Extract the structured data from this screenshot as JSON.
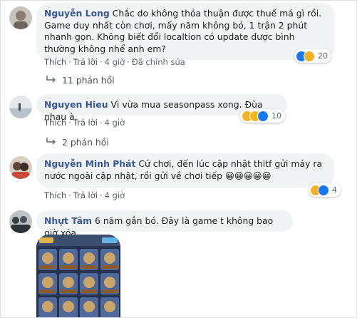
{
  "colors": {
    "name": "#385898",
    "link": "#4b4f56",
    "bubble": "#f2f3f5",
    "like": "#1877f2",
    "haha": "#f7b125"
  },
  "comments": [
    {
      "author": "Nguyễn Long",
      "text": "Chắc do không thỏa thuận được thuế má gì rồi. Game duy nhất còn chơi, mấy năm không bỏ, 1 trận 2 phút nhanh gọn. Không biết đổi localtion có update được bình thường không nhể anh em?",
      "like": "Thích",
      "reply": "Trả lời",
      "time": "4 giờ",
      "edited": "Đã chỉnh sửa",
      "reactions": {
        "icons": [
          "like-icon",
          "sad-icon"
        ],
        "count": "20"
      },
      "replies": "11 phản hồi"
    },
    {
      "author": "Nguyen Hieu",
      "text": "Vì vừa mua seasonpass xong. Đùa nhau à.",
      "like": "Thích",
      "reply": "Trả lời",
      "time": "4 giờ",
      "reactions": {
        "icons": [
          "haha-icon",
          "sad-icon",
          "like-icon"
        ],
        "count": "10"
      },
      "replies": "2 phản hồi"
    },
    {
      "author": "Nguyễn Minh Phát",
      "text": "Cứ chơi, đến lúc cập nhật thitf gửi máy ra nước ngoài cập nhật, rồi gửi về chơi tiếp 😀😀😀😀😀",
      "like": "Thích",
      "reply": "Trả lời",
      "time": "4 giờ",
      "reactions": {
        "icons": [
          "haha-icon",
          "like-icon"
        ],
        "count": "4"
      }
    },
    {
      "author": "Nhựt Tâm",
      "text": "6 năm gắn bó. Đây là game t không bao giờ xóa"
    }
  ]
}
